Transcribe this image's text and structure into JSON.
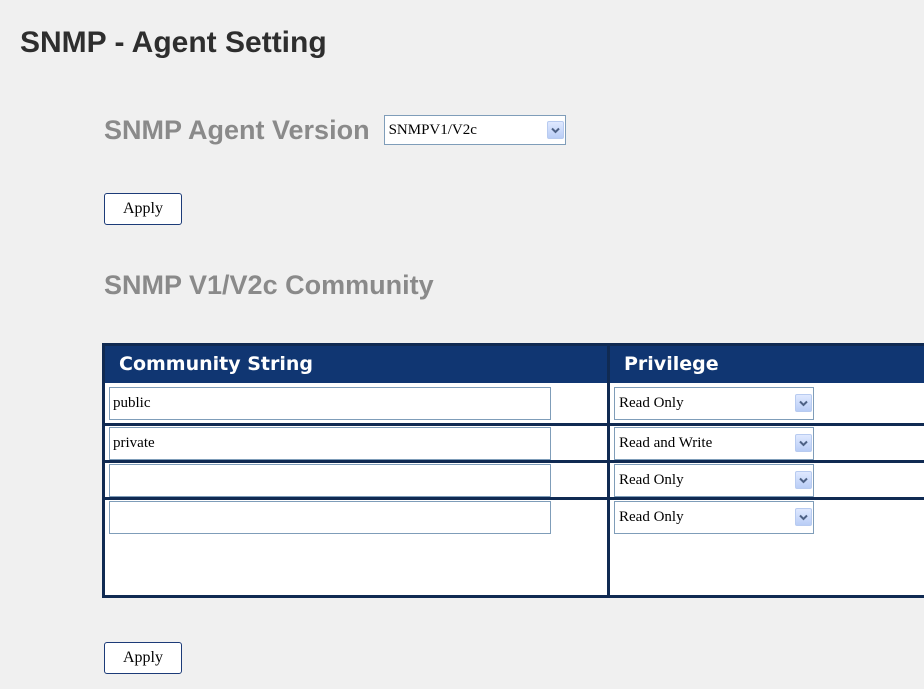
{
  "page": {
    "title": "SNMP - Agent Setting"
  },
  "agent": {
    "label": "SNMP Agent Version",
    "version": "SNMPV1/V2c",
    "apply_label": "Apply"
  },
  "community": {
    "heading": "SNMP V1/V2c Community",
    "columns": [
      "Community String",
      "Privilege"
    ],
    "rows": [
      {
        "community": "public",
        "privilege": "Read Only"
      },
      {
        "community": "private",
        "privilege": "Read and Write"
      },
      {
        "community": "",
        "privilege": "Read Only"
      },
      {
        "community": "",
        "privilege": "Read Only"
      }
    ],
    "apply_label": "Apply"
  },
  "icons": {
    "dropdown": "chevron-down-icon"
  },
  "colors": {
    "table_header": "#103672",
    "table_border": "#102a52",
    "heading_gray": "#8a8a8a",
    "background": "#f0f0f0"
  }
}
